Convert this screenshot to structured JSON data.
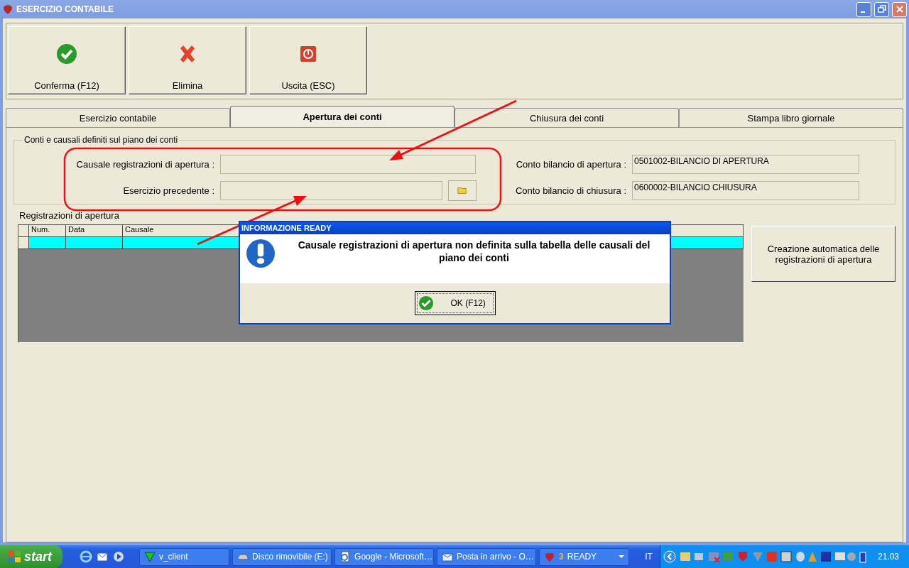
{
  "window": {
    "title": "ESERCIZIO CONTABILE"
  },
  "toolbar": [
    {
      "label": "Conferma (F12)",
      "kind": "confirm"
    },
    {
      "label": "Elimina",
      "kind": "delete"
    },
    {
      "label": "Uscita (ESC)",
      "kind": "exit"
    }
  ],
  "tabs": [
    {
      "label": "Esercizio contabile",
      "selected": false
    },
    {
      "label": "Apertura dei conti",
      "selected": true
    },
    {
      "label": "Chiusura dei conti",
      "selected": false
    },
    {
      "label": "Stampa libro giornale",
      "selected": false
    }
  ],
  "group": {
    "title": "Conti e causali definiti sul piano dei conti",
    "left_fields": [
      {
        "label": "Causale registrazioni di apertura :",
        "browse": false
      },
      {
        "label": "Esercizio precedente :",
        "browse": true
      }
    ],
    "right_fields": [
      {
        "label": "Conto bilancio di apertura :",
        "value": "0501002-BILANCIO DI APERTURA"
      },
      {
        "label": "Conto bilancio di chiusura :",
        "value": "0600002-BILANCIO CHIUSURA"
      }
    ]
  },
  "grid": {
    "title": "Registrazioni di apertura",
    "columns": [
      "Num.",
      "Data",
      "Causale"
    ],
    "rows": [
      {
        "selected": true
      }
    ]
  },
  "auto_button": {
    "label": "Creazione automatica delle registrazioni di apertura"
  },
  "dialog": {
    "title": "INFORMAZIONE READY",
    "message": "Causale registrazioni di apertura non definita sulla tabella delle causali del piano dei conti",
    "ok": "OK (F12)"
  },
  "taskbar": {
    "start": "start",
    "quick_launch": [
      {
        "kind": "browser"
      },
      {
        "kind": "email"
      },
      {
        "kind": "media"
      }
    ],
    "tasks": [
      {
        "label": "v_client",
        "kind": "client"
      },
      {
        "label": "Disco rimovibile (E:)",
        "kind": "drive"
      },
      {
        "label": "Google - Microsoft…",
        "kind": "browser"
      },
      {
        "label": "Posta in arrivo - O…",
        "kind": "mail"
      },
      {
        "label": "READY",
        "kind": "app",
        "count": "3"
      }
    ],
    "language": "IT",
    "clock": "21.03"
  }
}
